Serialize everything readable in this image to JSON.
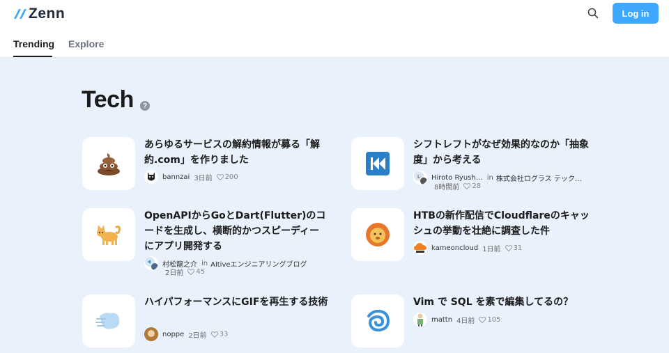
{
  "header": {
    "logo_text": "Zenn",
    "login_label": "Log in"
  },
  "tabs": [
    {
      "label": "Trending",
      "active": true
    },
    {
      "label": "Explore",
      "active": false
    }
  ],
  "section": {
    "title": "Tech",
    "help_label": "?"
  },
  "articles": [
    {
      "title": "あらゆるサービスの解約情報が募る「解約.com」を作りました",
      "emoji": "poop",
      "author": "bannzai",
      "time": "3日前",
      "likes": "200"
    },
    {
      "title": "シフトレフトがなぜ効果的なのか「抽象度」から考える",
      "emoji": "rewind-button",
      "author": "Hiroto Ryush…",
      "in_label": "in",
      "publication": "株式会社ログラス テック…",
      "time": "8時間前",
      "likes": "28"
    },
    {
      "title": "OpenAPIからGoとDart(Flutter)のコードを生成し、横断的かつスピーディーにアプリ開発する",
      "emoji": "cat",
      "author": "村松龍之介",
      "in_label": "in",
      "publication": "Altiveエンジニアリングブログ",
      "time": "2日前",
      "likes": "45"
    },
    {
      "title": "HTBの新作配信でCloudflareのキャッシュの挙動を壮絶に調査した件",
      "emoji": "lion",
      "author": "kameoncloud",
      "time": "1日前",
      "likes": "31"
    },
    {
      "title": "ハイパフォーマンスにGIFを再生する技術",
      "emoji": "wind",
      "author": "noppe",
      "time": "2日前",
      "likes": "33"
    },
    {
      "title": "Vim で SQL を素で編集してるの？",
      "emoji": "cyclone",
      "author": "mattn",
      "time": "4日前",
      "likes": "105"
    }
  ],
  "colors": {
    "accent": "#3ea8ff",
    "background": "#e8f1fc"
  }
}
